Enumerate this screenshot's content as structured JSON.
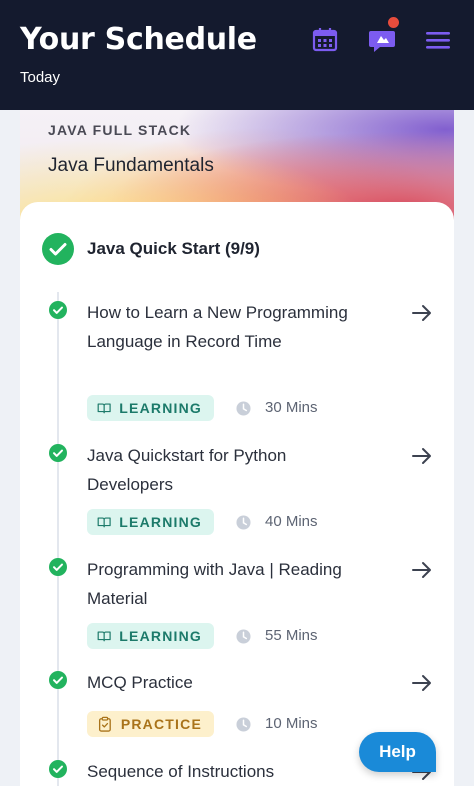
{
  "header": {
    "title": "Your Schedule",
    "subtitle": "Today",
    "icons": [
      "calendar-icon",
      "chat-icon",
      "menu-icon"
    ],
    "accent": "#7c5cf0",
    "notification_color": "#e74c3c"
  },
  "banner": {
    "kicker": "JAVA FULL STACK",
    "course": "Java Fundamentals"
  },
  "section": {
    "title": "Java Quick Start (9/9)",
    "status_color": "#22b35e"
  },
  "items": [
    {
      "title": "How to Learn a New Programming Language in Record Time",
      "tag": "LEARNING",
      "duration": "30 Mins",
      "completed": true
    },
    {
      "title": "Java Quickstart for Python Developers",
      "tag": "LEARNING",
      "duration": "40 Mins",
      "completed": true
    },
    {
      "title": "Programming with Java | Reading Material",
      "tag": "LEARNING",
      "duration": "55 Mins",
      "completed": true
    },
    {
      "title": "MCQ Practice",
      "tag": "PRACTICE",
      "duration": "10 Mins",
      "completed": true
    },
    {
      "title": "Sequence of Instructions",
      "completed": true
    }
  ],
  "help": {
    "label": "Help",
    "color": "#1a8ad8"
  }
}
